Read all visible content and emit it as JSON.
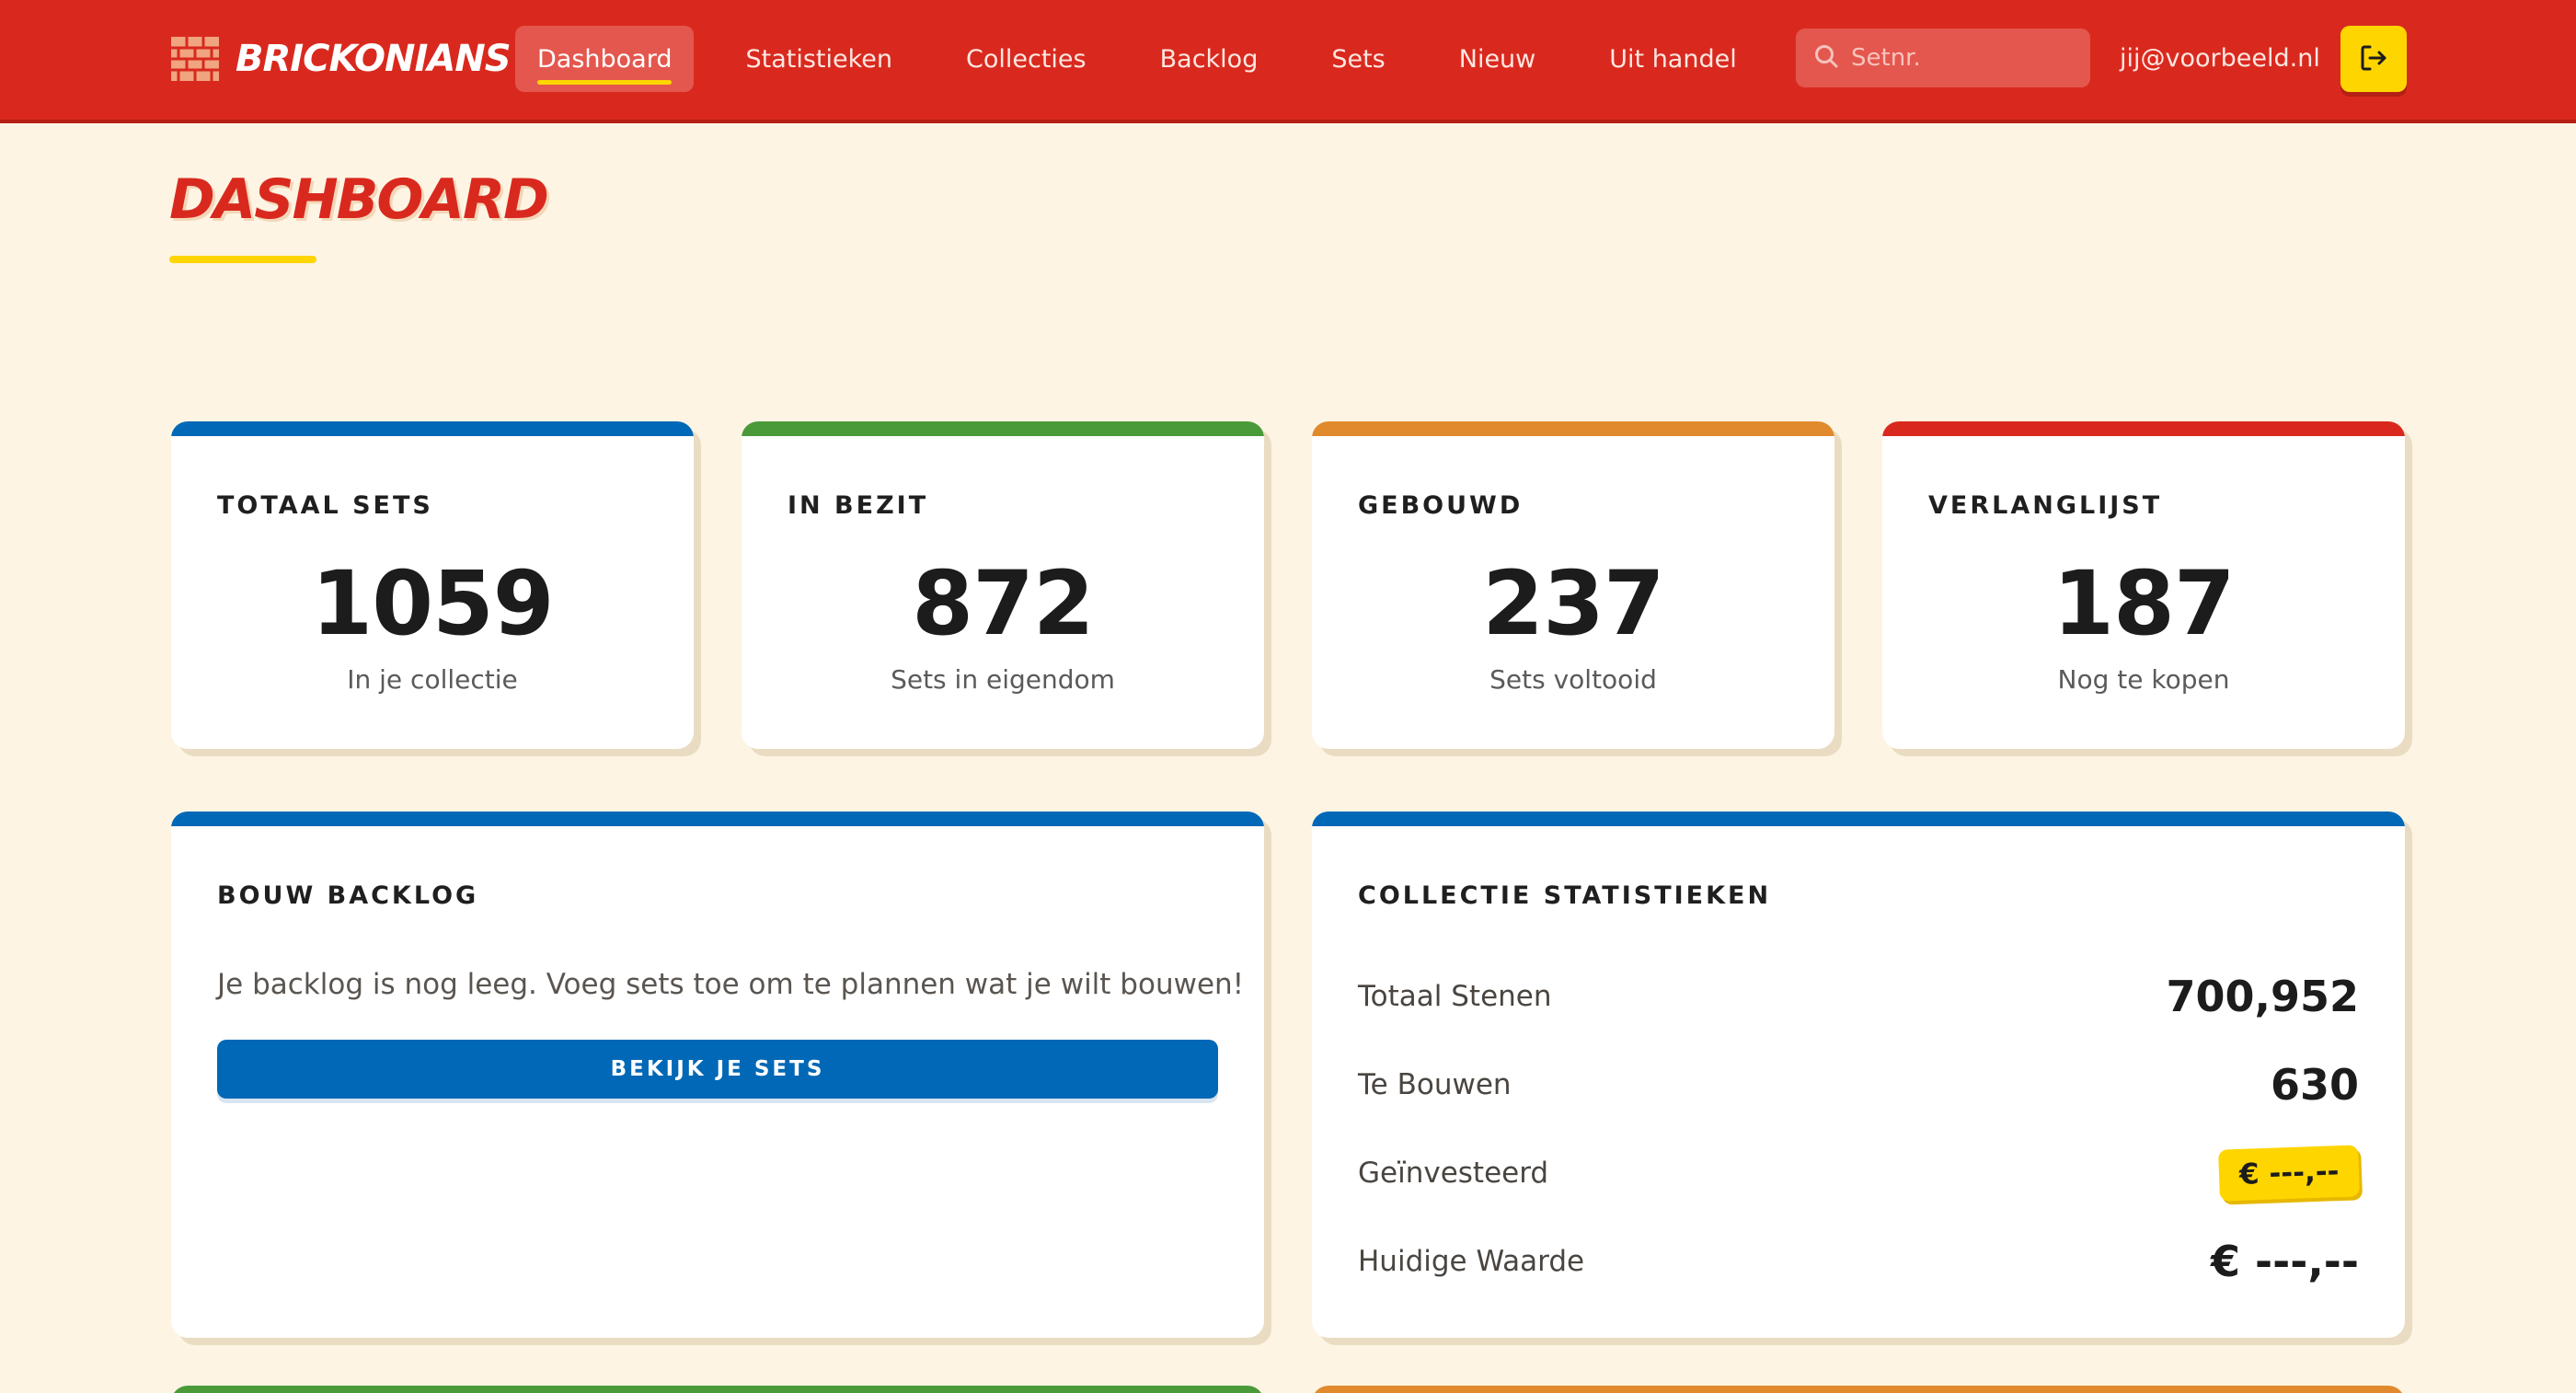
{
  "app": {
    "brand": "Brickonians"
  },
  "nav": {
    "items": [
      {
        "label": "Dashboard",
        "active": true
      },
      {
        "label": "Statistieken"
      },
      {
        "label": "Collecties"
      },
      {
        "label": "Backlog"
      },
      {
        "label": "Sets"
      },
      {
        "label": "Nieuw"
      },
      {
        "label": "Uit handel"
      }
    ]
  },
  "search": {
    "placeholder": "Setnr.",
    "value": ""
  },
  "user": {
    "email": "jij@voorbeeld.nl"
  },
  "page": {
    "title": "Dashboard"
  },
  "stats": [
    {
      "label": "Totaal Sets",
      "value": "1059",
      "sub": "In je collectie",
      "color": "#0068b6"
    },
    {
      "label": "In Bezit",
      "value": "872",
      "sub": "Sets in eigendom",
      "color": "#4a9a39"
    },
    {
      "label": "Gebouwd",
      "value": "237",
      "sub": "Sets voltooid",
      "color": "#e08a2d"
    },
    {
      "label": "Verlanglijst",
      "value": "187",
      "sub": "Nog te kopen",
      "color": "#d9291e"
    }
  ],
  "backlog": {
    "title": "Bouw Backlog",
    "empty_text": "Je backlog is nog leeg. Voeg sets toe om te plannen wat je wilt bouwen!",
    "button_label": "BEKIJK JE SETS"
  },
  "collection_stats": {
    "title": "Collectie Statistieken",
    "rows": [
      {
        "label": "Totaal Stenen",
        "value": "700,952"
      },
      {
        "label": "Te Bouwen",
        "value": "630"
      },
      {
        "label": "Geïnvesteerd",
        "value": "€ ---,--"
      },
      {
        "label": "Huidige Waarde",
        "value": "€ ---,--"
      }
    ]
  },
  "colors": {
    "header_red": "#d9291e",
    "accent_yellow": "#ffd500",
    "blue": "#0068b6",
    "green": "#4a9a39",
    "orange": "#e08a2d",
    "background": "#fdf4e3"
  }
}
